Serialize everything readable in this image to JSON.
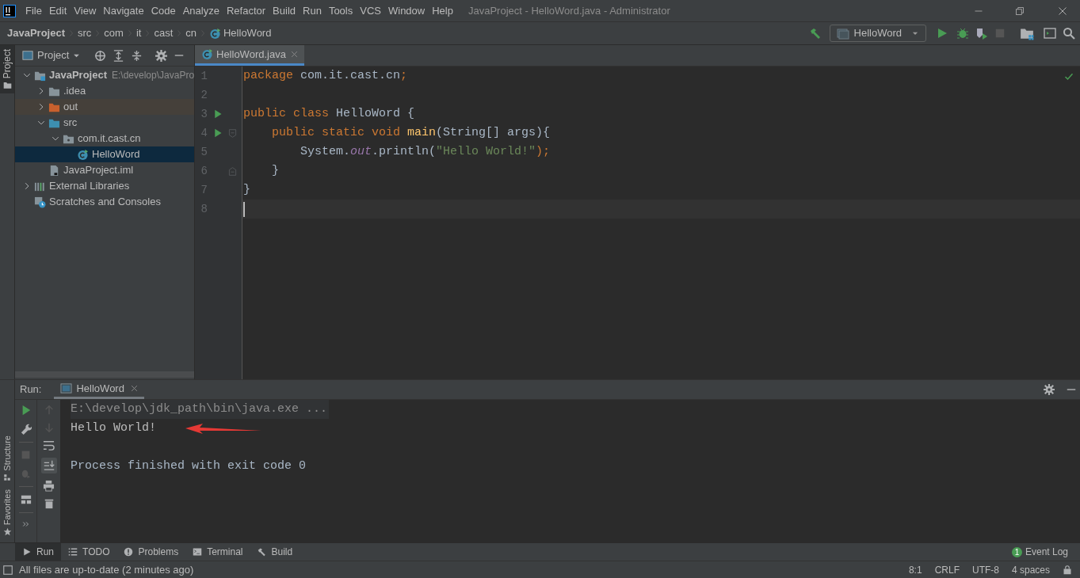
{
  "title_bar": {
    "menu": [
      "File",
      "Edit",
      "View",
      "Navigate",
      "Code",
      "Analyze",
      "Refactor",
      "Build",
      "Run",
      "Tools",
      "VCS",
      "Window",
      "Help"
    ],
    "title": "JavaProject - HelloWord.java - Administrator"
  },
  "breadcrumbs": [
    {
      "label": "JavaProject",
      "kind": "project"
    },
    {
      "label": "src",
      "kind": "plain"
    },
    {
      "label": "com",
      "kind": "plain"
    },
    {
      "label": "it",
      "kind": "plain"
    },
    {
      "label": "cast",
      "kind": "plain"
    },
    {
      "label": "cn",
      "kind": "plain"
    },
    {
      "label": "HelloWord",
      "kind": "class"
    }
  ],
  "run_config": {
    "label": "HelloWord"
  },
  "left_tool_tabs": [
    {
      "label": "Project",
      "selected": true
    }
  ],
  "left_bottom_tabs": [
    {
      "label": "Structure",
      "selected": false
    },
    {
      "label": "Favorites",
      "selected": false
    }
  ],
  "project_panel": {
    "title": "Project",
    "tree": [
      {
        "label": "JavaProject",
        "path": "E:\\develop\\JavaPro",
        "kind": "project",
        "expanded": true,
        "selected": false,
        "children": [
          {
            "label": ".idea",
            "kind": "folder",
            "expanded": false,
            "selected": false
          },
          {
            "label": "out",
            "kind": "excluded",
            "expanded": false,
            "selected": false
          },
          {
            "label": "src",
            "kind": "source",
            "expanded": true,
            "selected": false,
            "children": [
              {
                "label": "com.it.cast.cn",
                "kind": "package",
                "expanded": true,
                "selected": false,
                "children": [
                  {
                    "label": "HelloWord",
                    "kind": "class",
                    "selected": true
                  }
                ]
              }
            ]
          },
          {
            "label": "JavaProject.iml",
            "kind": "file",
            "selected": false
          }
        ]
      },
      {
        "label": "External Libraries",
        "kind": "libraries",
        "expanded": false,
        "selected": false
      },
      {
        "label": "Scratches and Consoles",
        "kind": "scratches",
        "selected": false
      }
    ]
  },
  "editor": {
    "tabs": [
      {
        "label": "HelloWord.java",
        "selected": true
      }
    ],
    "lines": [
      {
        "number": "1",
        "run": false,
        "fold_open": false,
        "fold_close": false,
        "current": false,
        "tokens": [
          {
            "text": "package ",
            "kind": "keyword"
          },
          {
            "text": "com.it.cast.cn",
            "kind": "plain"
          },
          {
            "text": ";",
            "kind": "keyword"
          }
        ]
      },
      {
        "number": "2",
        "run": false,
        "fold_open": false,
        "fold_close": false,
        "current": false
      },
      {
        "number": "3",
        "run": true,
        "fold_open": false,
        "fold_close": false,
        "current": false,
        "tokens": [
          {
            "text": "public class ",
            "kind": "keyword"
          },
          {
            "text": "HelloWord {",
            "kind": "plain"
          }
        ]
      },
      {
        "number": "4",
        "run": true,
        "fold_open": true,
        "fold_close": false,
        "current": false,
        "tokens": [
          {
            "text": "    public static void ",
            "kind": "keyword"
          },
          {
            "text": "main",
            "kind": "method"
          },
          {
            "text": "(String[] args){",
            "kind": "plain"
          }
        ]
      },
      {
        "number": "5",
        "run": false,
        "fold_open": false,
        "fold_close": false,
        "current": false,
        "tokens": [
          {
            "text": "        System.",
            "kind": "plain"
          },
          {
            "text": "out",
            "kind": "static"
          },
          {
            "text": ".println(",
            "kind": "plain"
          },
          {
            "text": "\"Hello World!\"",
            "kind": "string"
          },
          {
            "text": ");",
            "kind": "keyword"
          }
        ]
      },
      {
        "number": "6",
        "run": false,
        "fold_open": false,
        "fold_close": true,
        "current": false,
        "tokens": [
          {
            "text": "    }",
            "kind": "plain"
          }
        ]
      },
      {
        "number": "7",
        "run": false,
        "fold_open": false,
        "fold_close": false,
        "current": false,
        "tokens": [
          {
            "text": "}",
            "kind": "plain"
          }
        ]
      },
      {
        "number": "8",
        "run": false,
        "fold_open": false,
        "fold_close": false,
        "current": true
      }
    ]
  },
  "run_panel": {
    "title": "Run:",
    "tabs": [
      {
        "label": "HelloWord",
        "selected": true
      }
    ],
    "console": [
      {
        "text": "E:\\develop\\jdk_path\\bin\\java.exe ...",
        "kind": "command"
      },
      {
        "text": "Hello World!",
        "kind": "output"
      },
      {
        "text": "Process finished with exit code 0",
        "kind": "exit"
      }
    ]
  },
  "bottom_tabs": [
    {
      "label": "Run",
      "kind": "run",
      "selected": true
    },
    {
      "label": "TODO",
      "kind": "todo",
      "selected": false
    },
    {
      "label": "Problems",
      "kind": "problems",
      "selected": false
    },
    {
      "label": "Terminal",
      "kind": "terminal",
      "selected": false
    },
    {
      "label": "Build",
      "kind": "build",
      "selected": false
    }
  ],
  "event_log": {
    "label": "Event Log",
    "badge": "1"
  },
  "status_bar": {
    "message": "All files are up-to-date (2 minutes ago)",
    "items": [
      "8:1",
      "CRLF",
      "UTF-8",
      "4 spaces"
    ]
  }
}
